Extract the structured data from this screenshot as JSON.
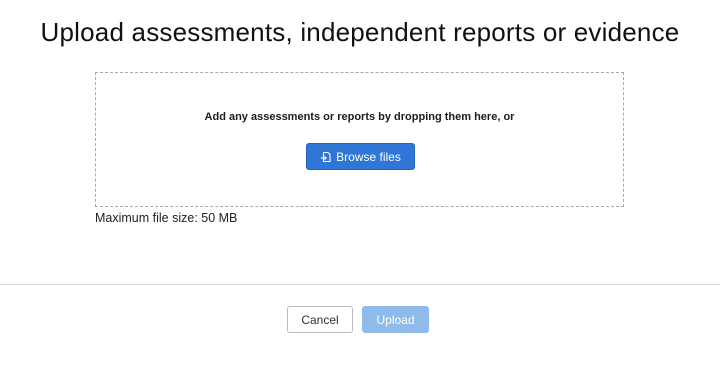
{
  "dialog": {
    "title": "Upload assessments, independent reports or evidence"
  },
  "dropzone": {
    "prompt": "Add any assessments or reports by dropping them here, or",
    "browse_label": "Browse files",
    "browse_icon": "file-upload-icon"
  },
  "limits": {
    "max_size_text": "Maximum file size: 50 MB"
  },
  "footer": {
    "cancel_label": "Cancel",
    "upload_label": "Upload",
    "upload_disabled": true
  },
  "colors": {
    "primary": "#2f76d6",
    "primary_disabled": "#8fbbea",
    "border_dashed": "#a9a9a9",
    "divider": "#d6d6d6"
  }
}
